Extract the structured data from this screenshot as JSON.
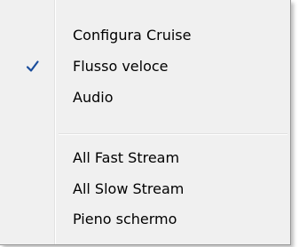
{
  "menu": {
    "items": [
      {
        "label": "Configura Cruise",
        "checked": false
      },
      {
        "label": "Flusso veloce",
        "checked": true
      },
      {
        "label": "Audio",
        "checked": false
      }
    ],
    "items2": [
      {
        "label": "All Fast Stream",
        "checked": false
      },
      {
        "label": "All Slow Stream",
        "checked": false
      },
      {
        "label": "Pieno schermo",
        "checked": false
      }
    ],
    "check_icon": "checkmark-icon",
    "check_color": "#1a4d9c"
  }
}
